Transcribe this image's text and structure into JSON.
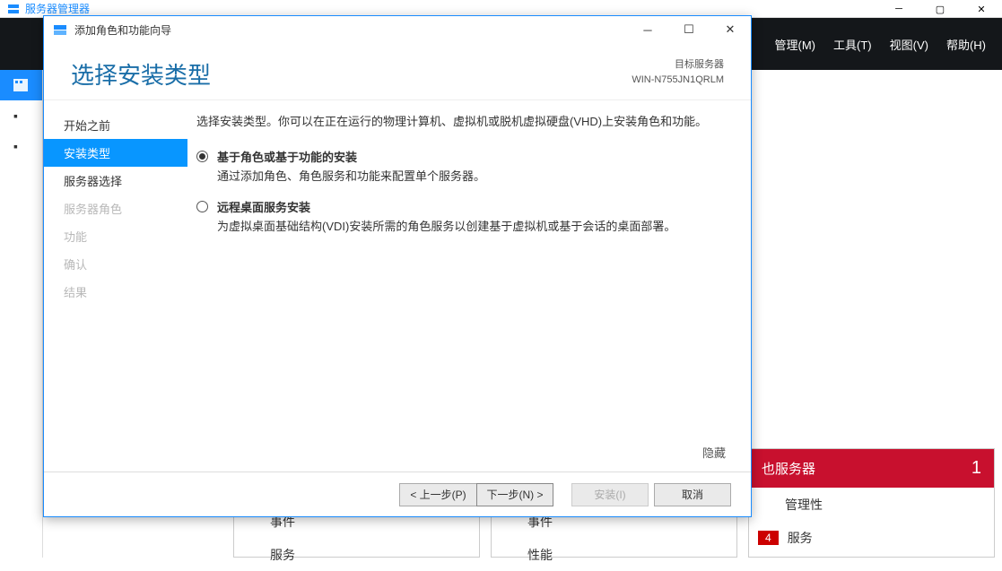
{
  "parent": {
    "title": "服务器管理器",
    "menu": [
      {
        "label": "管理(M)"
      },
      {
        "label": "工具(T)"
      },
      {
        "label": "视图(V)"
      },
      {
        "label": "帮助(H)"
      }
    ]
  },
  "bg_panels": {
    "p1": {
      "row1": "事件",
      "row2": "服务"
    },
    "p2": {
      "row1": "事件",
      "row2": "性能"
    },
    "p3": {
      "title": "也服务器",
      "count": "1",
      "row1": "管理性",
      "row2": "服务",
      "badge": "4"
    }
  },
  "wizard": {
    "titlebar": "添加角色和功能向导",
    "header_title": "选择安装类型",
    "target_label": "目标服务器",
    "target_name": "WIN-N755JN1QRLM",
    "nav": [
      {
        "label": "开始之前",
        "state": ""
      },
      {
        "label": "安装类型",
        "state": "active"
      },
      {
        "label": "服务器选择",
        "state": ""
      },
      {
        "label": "服务器角色",
        "state": "disabled"
      },
      {
        "label": "功能",
        "state": "disabled"
      },
      {
        "label": "确认",
        "state": "disabled"
      },
      {
        "label": "结果",
        "state": "disabled"
      }
    ],
    "intro": "选择安装类型。你可以在正在运行的物理计算机、虚拟机或脱机虚拟硬盘(VHD)上安装角色和功能。",
    "options": [
      {
        "title": "基于角色或基于功能的安装",
        "desc": "通过添加角色、角色服务和功能来配置单个服务器。",
        "checked": true
      },
      {
        "title": "远程桌面服务安装",
        "desc": "为虚拟桌面基础结构(VDI)安装所需的角色服务以创建基于虚拟机或基于会话的桌面部署。",
        "checked": false
      }
    ],
    "hide_label": "隐藏",
    "buttons": {
      "prev": "< 上一步(P)",
      "next": "下一步(N) >",
      "install": "安装(I)",
      "cancel": "取消"
    }
  }
}
